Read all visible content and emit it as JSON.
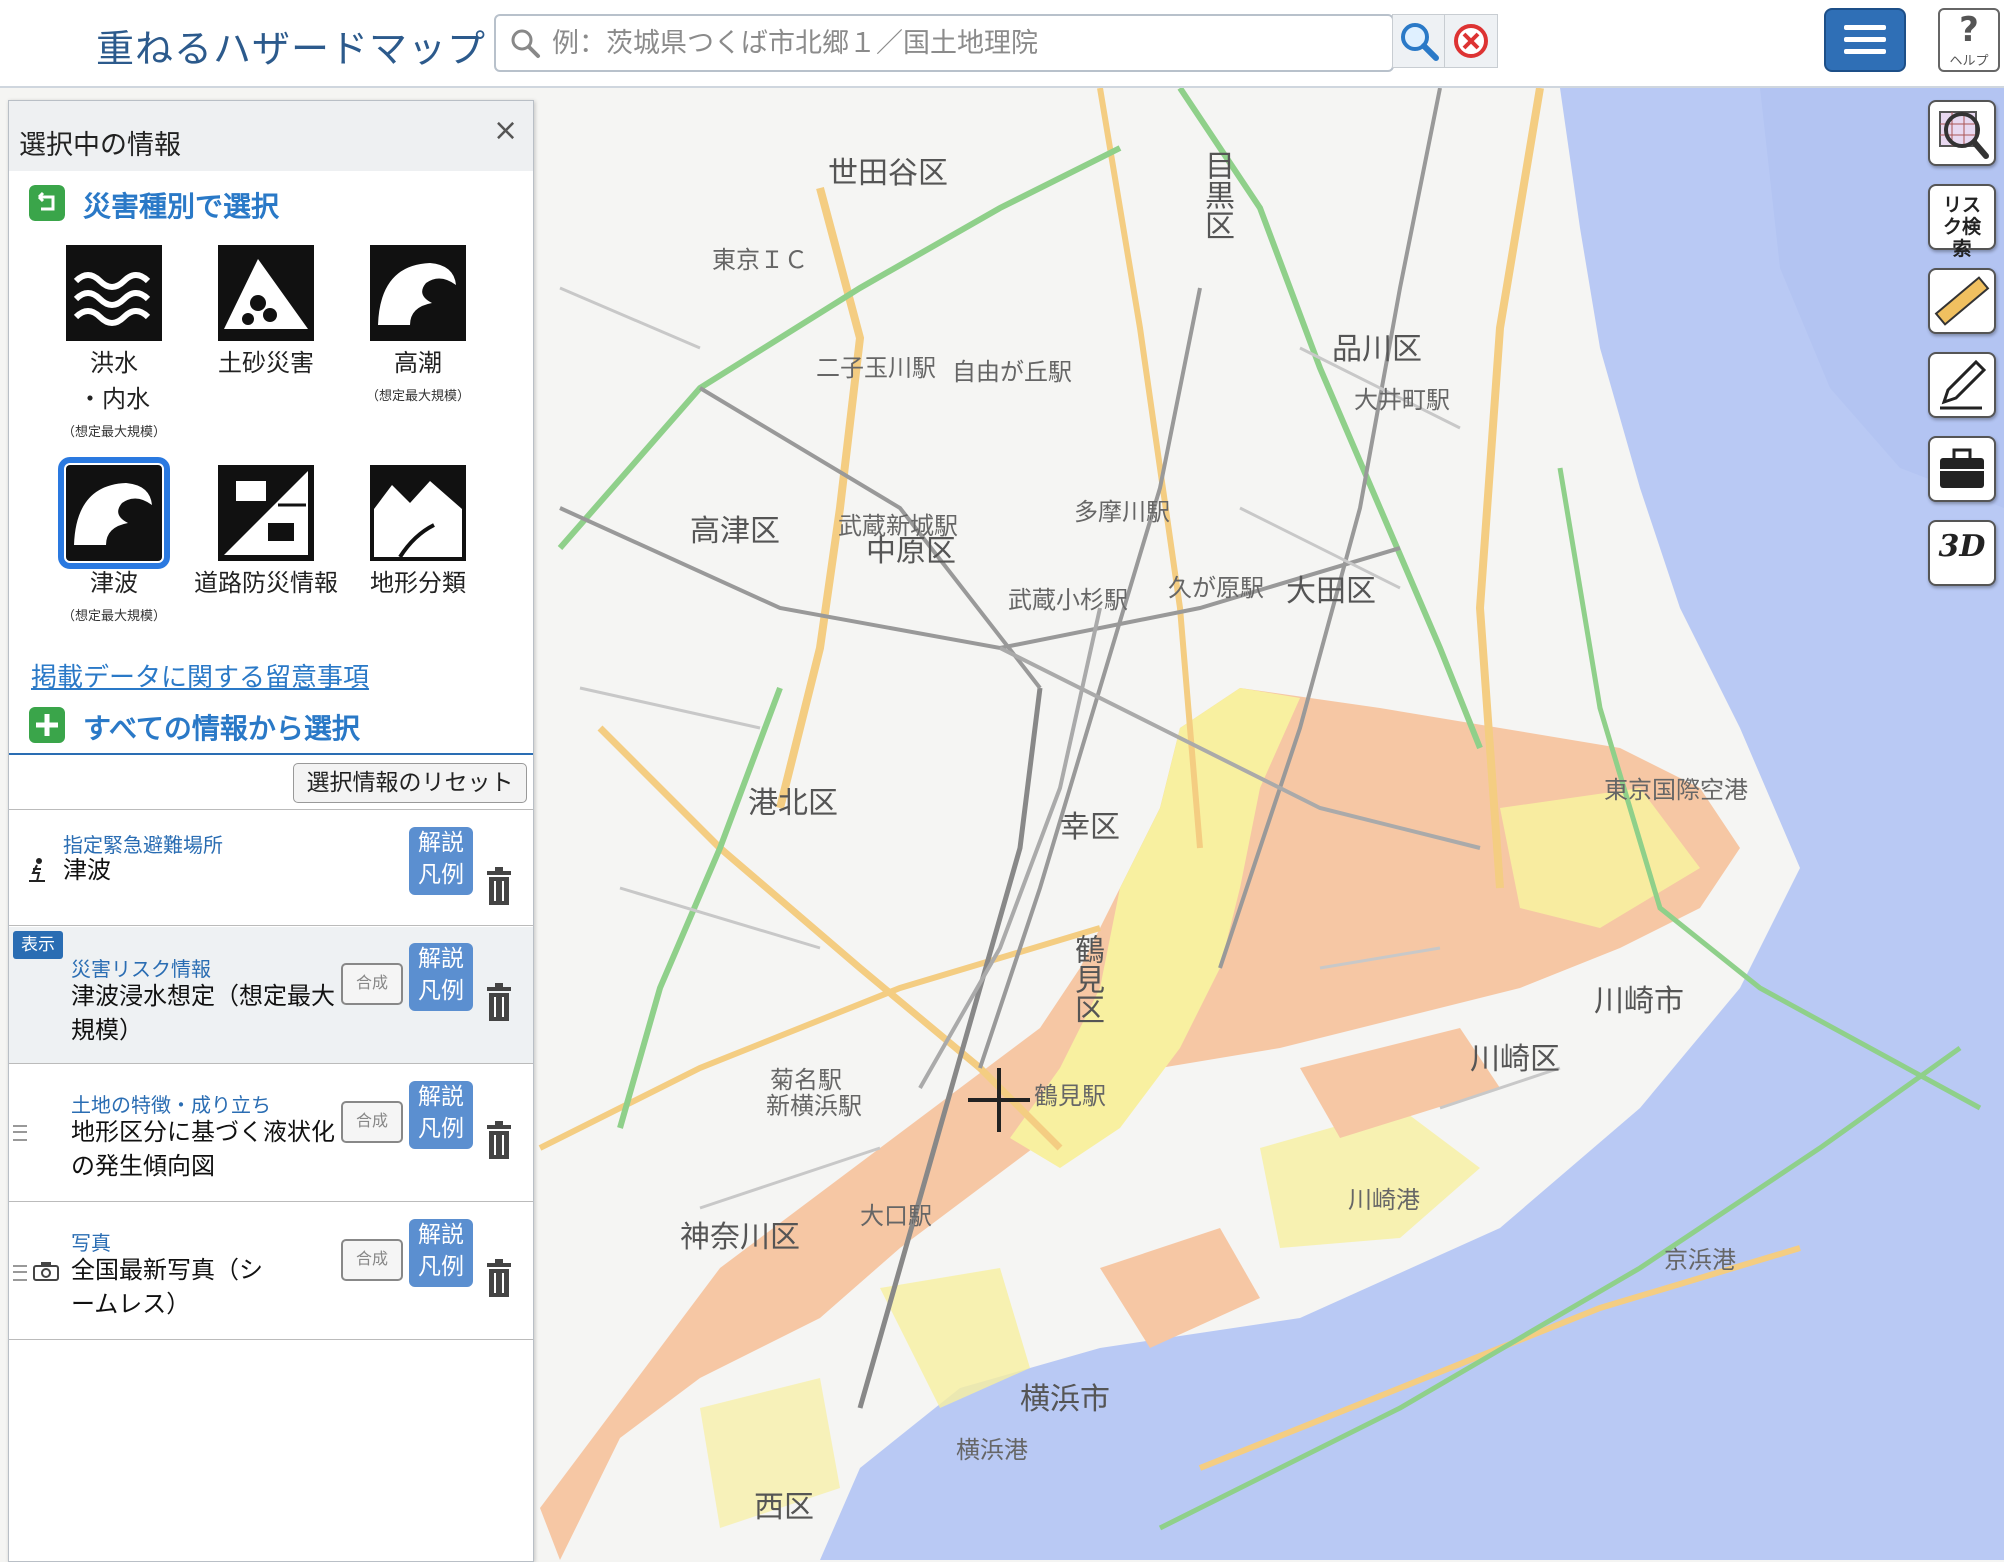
{
  "header": {
    "title": "重ねるハザードマップ",
    "search_placeholder": "例：茨城県つくば市北郷１／国土地理院",
    "help_label": "ヘルプ"
  },
  "tools": {
    "risk_search": "リスク検索",
    "three_d": "3D"
  },
  "map": {
    "labels": [
      {
        "text": "世田谷区",
        "kind": "big"
      },
      {
        "text": "目黒区",
        "kind": "big"
      },
      {
        "text": "品川区",
        "kind": "big"
      },
      {
        "text": "大田区",
        "kind": "big"
      },
      {
        "text": "高津区",
        "kind": "big"
      },
      {
        "text": "中原区",
        "kind": "big"
      },
      {
        "text": "港北区",
        "kind": "big"
      },
      {
        "text": "幸区",
        "kind": "big"
      },
      {
        "text": "鶴見区",
        "kind": "big"
      },
      {
        "text": "川崎区",
        "kind": "big"
      },
      {
        "text": "川崎市",
        "kind": "big"
      },
      {
        "text": "神奈川区",
        "kind": "big"
      },
      {
        "text": "横浜市",
        "kind": "big"
      },
      {
        "text": "西区",
        "kind": "big"
      },
      {
        "text": "東京国際空港",
        "kind": "normal"
      },
      {
        "text": "武蔵小杉駅",
        "kind": "normal"
      },
      {
        "text": "新横浜駅",
        "kind": "normal"
      },
      {
        "text": "自由が丘駅",
        "kind": "normal"
      },
      {
        "text": "多摩川駅",
        "kind": "normal"
      },
      {
        "text": "大井町駅",
        "kind": "normal"
      },
      {
        "text": "京浜港",
        "kind": "normal"
      },
      {
        "text": "横浜港",
        "kind": "normal"
      },
      {
        "text": "東京ＩＣ",
        "kind": "normal"
      },
      {
        "text": "菊名駅",
        "kind": "normal"
      },
      {
        "text": "鶴見駅",
        "kind": "normal"
      },
      {
        "text": "大口駅",
        "kind": "normal"
      },
      {
        "text": "川崎港",
        "kind": "normal"
      },
      {
        "text": "武蔵新城駅",
        "kind": "normal"
      },
      {
        "text": "二子玉川駅",
        "kind": "normal"
      },
      {
        "text": "久が原駅",
        "kind": "normal"
      }
    ]
  },
  "panel": {
    "title": "選択中の情報",
    "close": "×",
    "by_type_title": "災害種別で選択",
    "hazards": [
      {
        "name": "洪水",
        "name2": "・内水",
        "note": "（想定最大規模）",
        "icon": "flood-icon"
      },
      {
        "name": "土砂災害",
        "name2": "",
        "note": "",
        "icon": "landslide-icon"
      },
      {
        "name": "高潮",
        "name2": "",
        "note": "（想定最大規模）",
        "icon": "storm-surge-icon"
      },
      {
        "name": "津波",
        "name2": "",
        "note": "（想定最大規模）",
        "icon": "tsunami-icon"
      },
      {
        "name": "道路防災情報",
        "name2": "",
        "note": "",
        "icon": "road-disaster-icon"
      },
      {
        "name": "地形分類",
        "name2": "",
        "note": "",
        "icon": "terrain-icon"
      }
    ],
    "notice_link": "掲載データに関する留意事項",
    "all_info_title": "すべての情報から選択",
    "reset_label": "選択情報のリセット",
    "layers": [
      {
        "category": "指定緊急避難場所",
        "name": "津波",
        "badge": "",
        "merge": "",
        "legend1": "解説",
        "legend2": "凡例"
      },
      {
        "category": "災害リスク情報",
        "name": "津波浸水想定（想定最大規模）",
        "badge": "表示",
        "merge": "合成",
        "legend1": "解説",
        "legend2": "凡例"
      },
      {
        "category": "土地の特徴・成り立ち",
        "name": "地形区分に基づく液状化の発生傾向図",
        "badge": "",
        "merge": "合成",
        "legend1": "解説",
        "legend2": "凡例"
      },
      {
        "category": "写真",
        "name": "全国最新写真（シームレス）",
        "badge": "",
        "merge": "合成",
        "legend1": "解説",
        "legend2": "凡例"
      }
    ]
  },
  "colors": {
    "accent": "#2a79c7",
    "sea": "#b9c9f4",
    "tsunami_low": "#f8f0a0",
    "tsunami_mid": "#f6c7a4",
    "road_major": "#f4cd82",
    "road_green": "#8fd08a"
  }
}
